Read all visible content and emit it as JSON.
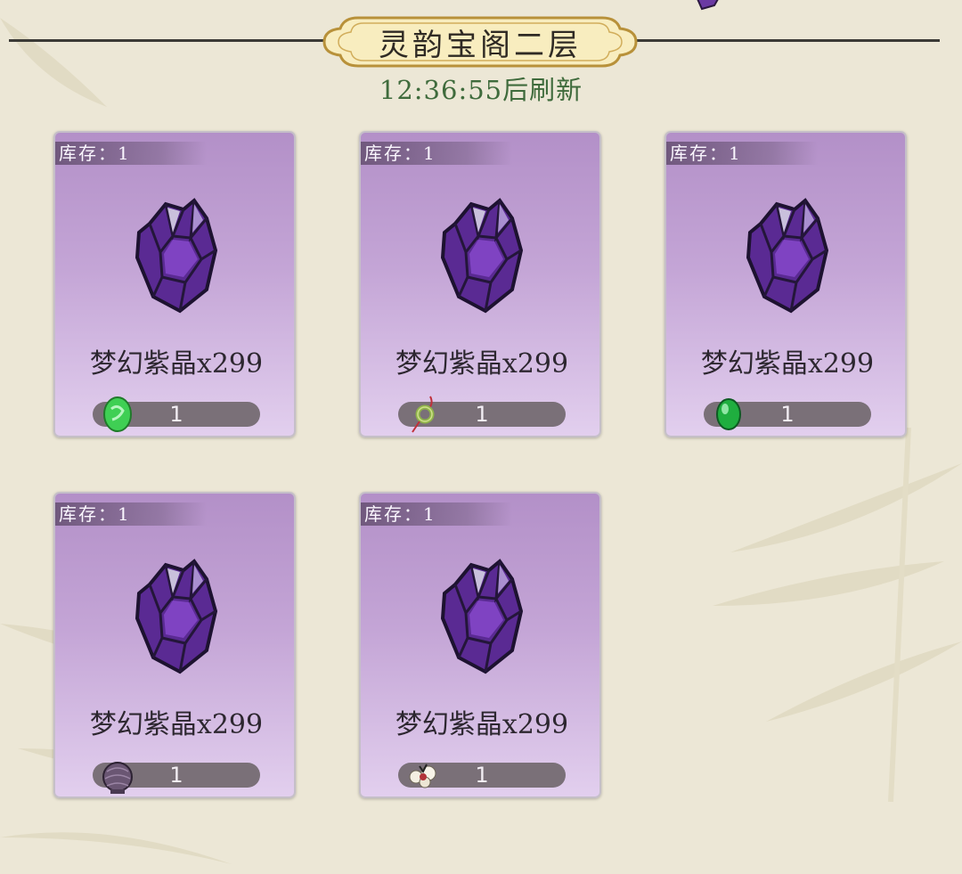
{
  "shop": {
    "title": "灵韵宝阁二层",
    "refresh_text": "12:36:55后刷新"
  },
  "items": [
    {
      "stock": "库存：1",
      "name": "梦幻紫晶x299",
      "price": "1",
      "currency_icon": "green-jade-icon"
    },
    {
      "stock": "库存：1",
      "name": "梦幻紫晶x299",
      "price": "1",
      "currency_icon": "jade-ring-pendant-icon"
    },
    {
      "stock": "库存：1",
      "name": "梦幻紫晶x299",
      "price": "1",
      "currency_icon": "emerald-stone-icon"
    },
    {
      "stock": "库存：1",
      "name": "梦幻紫晶x299",
      "price": "1",
      "currency_icon": "purple-jar-icon"
    },
    {
      "stock": "库存：1",
      "name": "梦幻紫晶x299",
      "price": "1",
      "currency_icon": "white-flower-icon"
    }
  ],
  "colors": {
    "background": "#ece7d6",
    "card_top": "#b390c8",
    "card_bottom": "#e2cfee",
    "price_bar": "#7a7078",
    "timer_green": "#3f6b3c"
  }
}
